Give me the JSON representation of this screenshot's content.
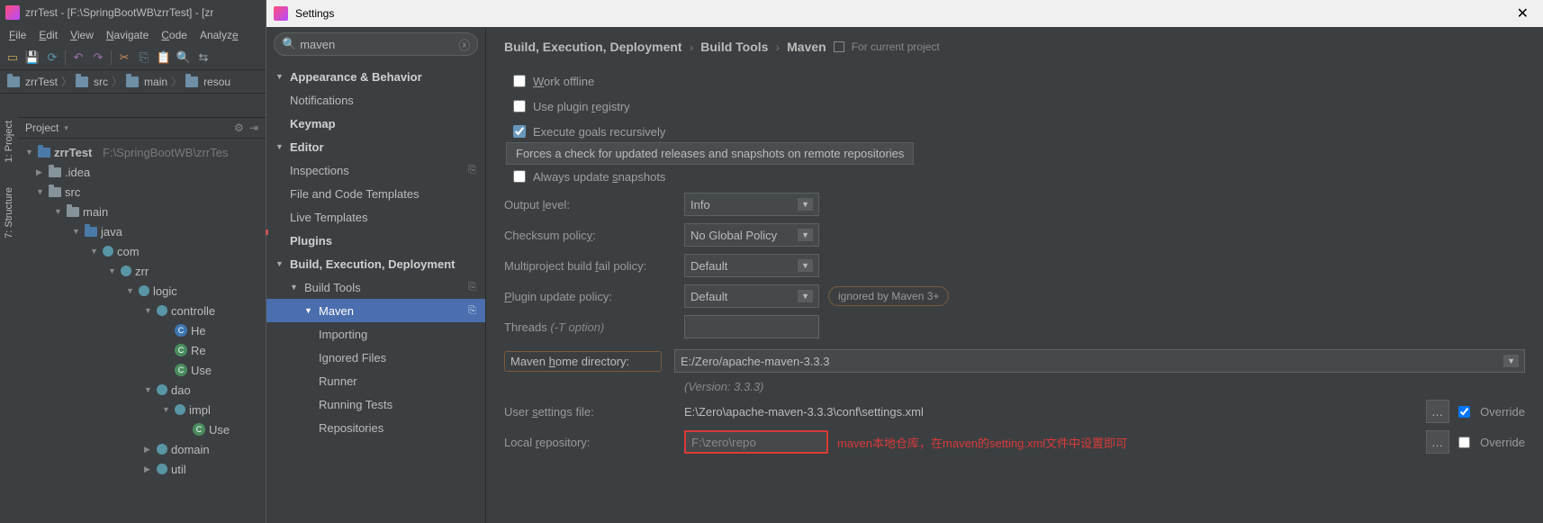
{
  "mainWindow": {
    "title": "zrrTest - [F:\\SpringBootWB\\zrrTest] - [zr",
    "menus": [
      "File",
      "Edit",
      "View",
      "Navigate",
      "Code",
      "Analyze"
    ],
    "navbar": [
      "zrrTest",
      "src",
      "main",
      "resou"
    ],
    "projectLabel": "Project",
    "sideTabs": [
      "1: Project",
      "7: Structure"
    ]
  },
  "projectTree": {
    "root": "zrrTest",
    "rootPath": "F:\\SpringBootWB\\zrrTes",
    "items": {
      "idea": ".idea",
      "src": "src",
      "main": "main",
      "java": "java",
      "com": "com",
      "zrr": "zrr",
      "logic": "logic",
      "controller": "controlle",
      "he": "He",
      "re": "Re",
      "use": "Use",
      "dao": "dao",
      "impl": "impl",
      "use2": "Use",
      "domain": "domain",
      "util": "util"
    }
  },
  "settings": {
    "title": "Settings",
    "searchValue": "maven",
    "categories": {
      "appearance": "Appearance & Behavior",
      "notifications": "Notifications",
      "keymap": "Keymap",
      "editor": "Editor",
      "inspections": "Inspections",
      "fileTemplates": "File and Code Templates",
      "liveTemplates": "Live Templates",
      "plugins": "Plugins",
      "build": "Build, Execution, Deployment",
      "buildTools": "Build Tools",
      "maven": "Maven",
      "importing": "Importing",
      "ignoredFiles": "Ignored Files",
      "runner": "Runner",
      "runningTests": "Running Tests",
      "repositories": "Repositories"
    },
    "breadcrumb": {
      "a": "Build, Execution, Deployment",
      "b": "Build Tools",
      "c": "Maven",
      "scope": "For current project"
    },
    "checks": {
      "workOffline": "Work offline",
      "usePluginRegistry": "Use plugin registry",
      "executeGoals": "Execute goals recursively",
      "alwaysUpdate": "Always update snapshots"
    },
    "tooltip": "Forces a check for updated releases and snapshots on remote repositories",
    "labels": {
      "outputLevel": "Output level:",
      "checksumPolicy": "Checksum policy:",
      "multiproject": "Multiproject build fail policy:",
      "pluginUpdate": "Plugin update policy:",
      "threads": "Threads",
      "threadsHint": "(-T option)",
      "mavenHome": "Maven home directory:",
      "userSettings": "User settings file:",
      "localRepo": "Local repository:",
      "override": "Override"
    },
    "values": {
      "outputLevel": "Info",
      "checksumPolicy": "No Global Policy",
      "multiproject": "Default",
      "pluginUpdate": "Default",
      "pluginBadge": "ignored by Maven 3+",
      "mavenHome": "E:/Zero/apache-maven-3.3.3",
      "mavenVersion": "(Version: 3.3.3)",
      "userSettings": "E:\\Zero\\apache-maven-3.3.3\\conf\\settings.xml",
      "localRepo": "F:\\zero\\repo",
      "annotation": "maven本地仓库，在maven的setting.xml文件中设置即可"
    }
  }
}
